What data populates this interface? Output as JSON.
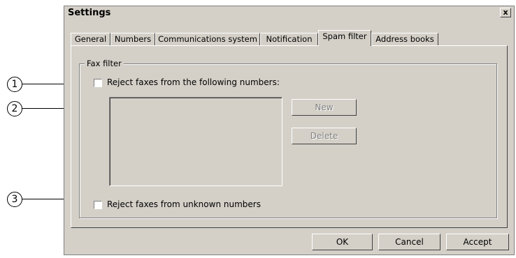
{
  "callouts": [
    "1",
    "2",
    "3"
  ],
  "dialog": {
    "title": "Settings",
    "close_symbol": "x"
  },
  "tabs": [
    "General",
    "Numbers",
    "Communications system",
    "Notification",
    "Spam filter",
    "Address books"
  ],
  "active_tab": "Spam filter",
  "fax_filter": {
    "group_label": "Fax filter",
    "reject_following_label": "Reject faxes from the following numbers:",
    "reject_following_checked": false,
    "new_label": "New",
    "delete_label": "Delete",
    "reject_unknown_label": "Reject faxes from unknown numbers",
    "reject_unknown_checked": false
  },
  "footer": {
    "ok_label": "OK",
    "cancel_label": "Cancel",
    "accept_label": "Accept"
  }
}
